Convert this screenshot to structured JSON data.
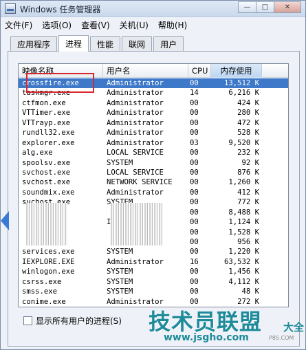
{
  "window": {
    "title": "Windows 任务管理器"
  },
  "window_buttons": {
    "minimize": "—",
    "maximize": "□",
    "close": "✕"
  },
  "menu": [
    "文件(F)",
    "选项(O)",
    "查看(V)",
    "关机(U)",
    "帮助(H)"
  ],
  "tabs": [
    "应用程序",
    "进程",
    "性能",
    "联网",
    "用户"
  ],
  "active_tab": "进程",
  "columns": [
    "映像名称",
    "用户名",
    "CPU",
    "内存使用"
  ],
  "processes": [
    {
      "name": "crossfire.exe",
      "user": "Administrator",
      "cpu": "00",
      "mem": "13,512 K"
    },
    {
      "name": "taskmgr.exe",
      "user": "Administrator",
      "cpu": "14",
      "mem": "6,216 K"
    },
    {
      "name": "ctfmon.exe",
      "user": "Administrator",
      "cpu": "00",
      "mem": "424 K"
    },
    {
      "name": "VTTimer.exe",
      "user": "Administrator",
      "cpu": "00",
      "mem": "280 K"
    },
    {
      "name": "VTTrayp.exe",
      "user": "Administrator",
      "cpu": "00",
      "mem": "472 K"
    },
    {
      "name": "rundll32.exe",
      "user": "Administrator",
      "cpu": "00",
      "mem": "528 K"
    },
    {
      "name": "explorer.exe",
      "user": "Administrator",
      "cpu": "03",
      "mem": "9,520 K"
    },
    {
      "name": "alg.exe",
      "user": "LOCAL SERVICE",
      "cpu": "00",
      "mem": "232 K"
    },
    {
      "name": "spoolsv.exe",
      "user": "SYSTEM",
      "cpu": "00",
      "mem": "92 K"
    },
    {
      "name": "svchost.exe",
      "user": "LOCAL SERVICE",
      "cpu": "00",
      "mem": "876 K"
    },
    {
      "name": "svchost.exe",
      "user": "NETWORK SERVICE",
      "cpu": "00",
      "mem": "1,260 K"
    },
    {
      "name": "soundmix.exe",
      "user": "Administrator",
      "cpu": "00",
      "mem": "412 K"
    },
    {
      "name": "svchost.exe",
      "user": "SYSTEM",
      "cpu": "00",
      "mem": "772 K"
    },
    {
      "name": "",
      "user": "",
      "cpu": "00",
      "mem": "8,488 K"
    },
    {
      "name": "",
      "user": "ICE",
      "cpu": "00",
      "mem": "1,124 K"
    },
    {
      "name": "",
      "user": "",
      "cpu": "00",
      "mem": "1,528 K"
    },
    {
      "name": "",
      "user": "",
      "cpu": "00",
      "mem": "956 K"
    },
    {
      "name": "services.exe",
      "user": "SYSTEM",
      "cpu": "00",
      "mem": "1,220 K"
    },
    {
      "name": "IEXPLORE.EXE",
      "user": "Administrator",
      "cpu": "16",
      "mem": "63,532 K"
    },
    {
      "name": "winlogon.exe",
      "user": "SYSTEM",
      "cpu": "00",
      "mem": "1,456 K"
    },
    {
      "name": "csrss.exe",
      "user": "SYSTEM",
      "cpu": "00",
      "mem": "4,112 K"
    },
    {
      "name": "smss.exe",
      "user": "SYSTEM",
      "cpu": "00",
      "mem": "48 K"
    },
    {
      "name": "conime.exe",
      "user": "Administrator",
      "cpu": "00",
      "mem": "272 K"
    }
  ],
  "show_all_users_label": "显示所有用户的进程(S)",
  "watermark": {
    "main": "技术员联盟",
    "side": "大全",
    "url": "www.jsgho.com",
    "small": "P85.COM"
  },
  "colors": {
    "selection": "#3d79c8",
    "highlight_box": "#d9262b",
    "watermark": "#1d8b9a"
  }
}
